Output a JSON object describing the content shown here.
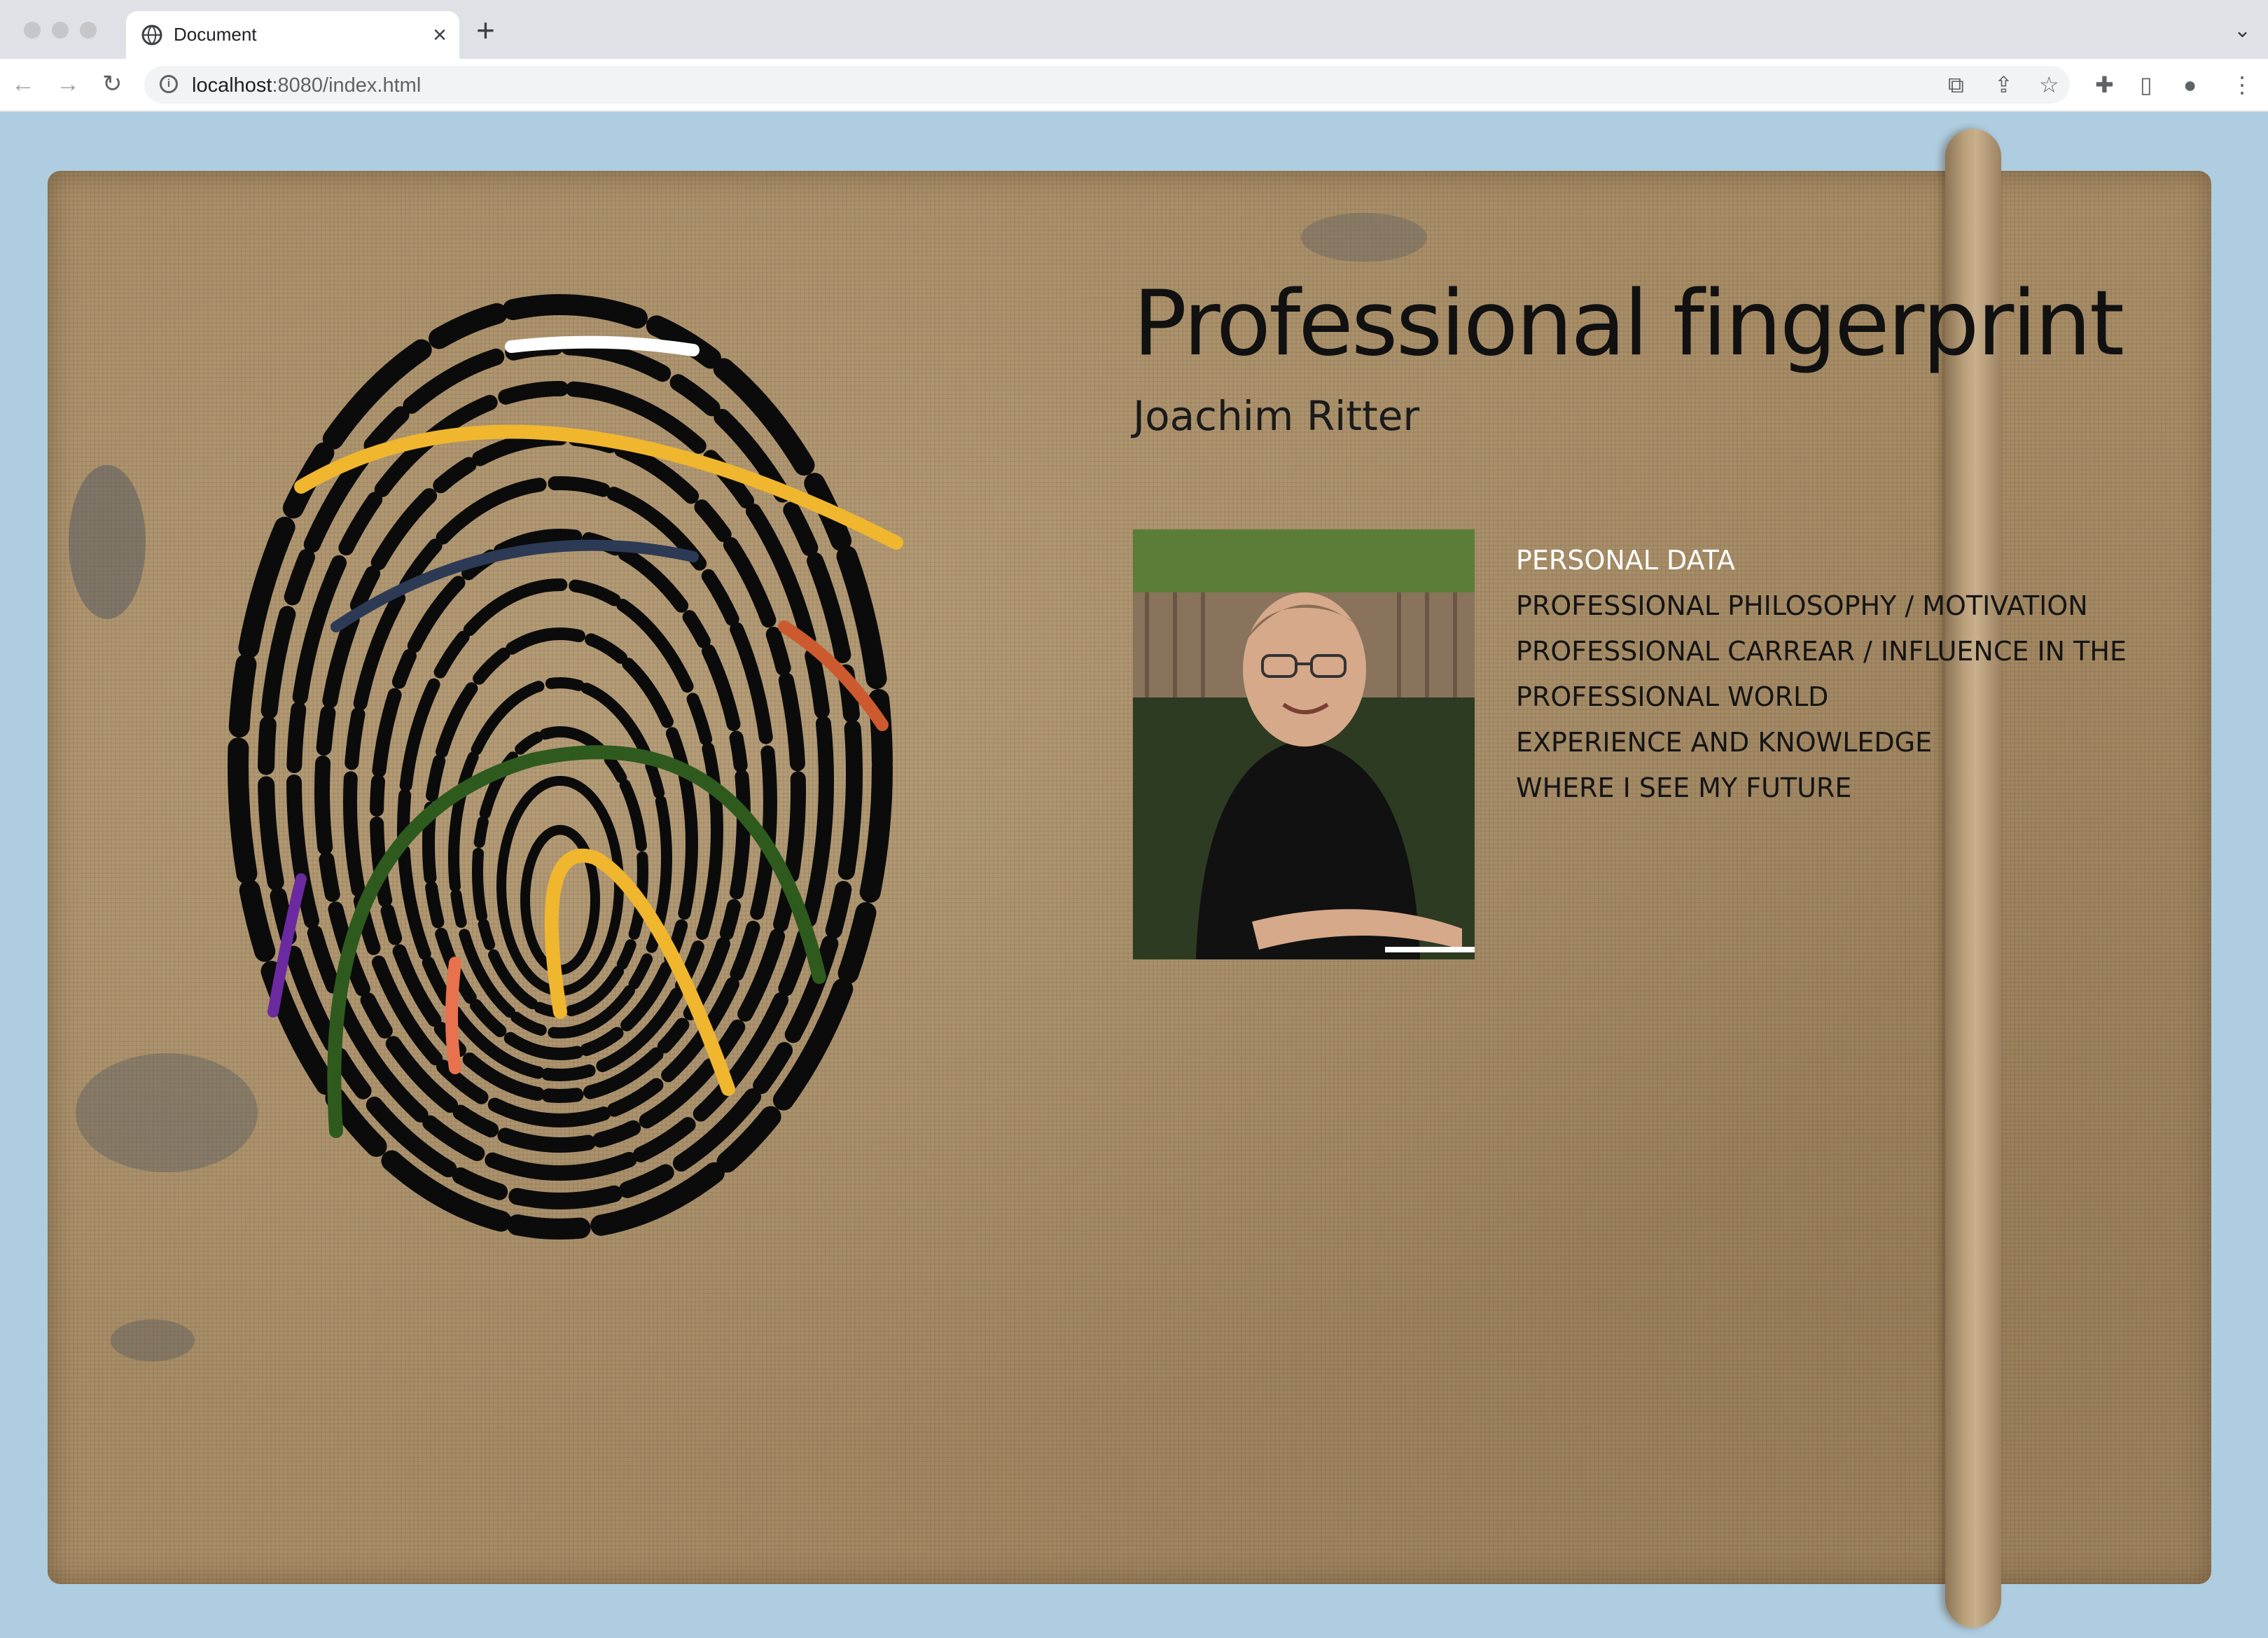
{
  "browser": {
    "tab_title": "Document",
    "url_host": "localhost",
    "url_path": ":8080/index.html"
  },
  "page": {
    "title": "Professional fingerprint",
    "author": "Joachim Ritter",
    "photo_alt": "Portrait of Joachim Ritter",
    "menu": [
      {
        "label": "Personal data",
        "active": true
      },
      {
        "label": "Professional philosophy / motivation",
        "active": false
      },
      {
        "label": "Professional carrear / influence in the",
        "active": false
      },
      {
        "label": "professional world",
        "active": false
      },
      {
        "label": "Experience and knowledge",
        "active": false
      },
      {
        "label": "Where I see my future",
        "active": false
      }
    ]
  },
  "colors": {
    "page_background": "#aecde0",
    "burlap": "#a88d66",
    "menu_active": "#ffffff",
    "menu_text": "#141414",
    "ridge_yellow": "#f0b62e",
    "ridge_navy": "#2c3a55",
    "ridge_orange": "#cc5a2e",
    "ridge_green": "#2f5a1e",
    "ridge_purple": "#6b2aa0",
    "ridge_coral": "#e8714e",
    "ridge_white": "#ffffff"
  }
}
